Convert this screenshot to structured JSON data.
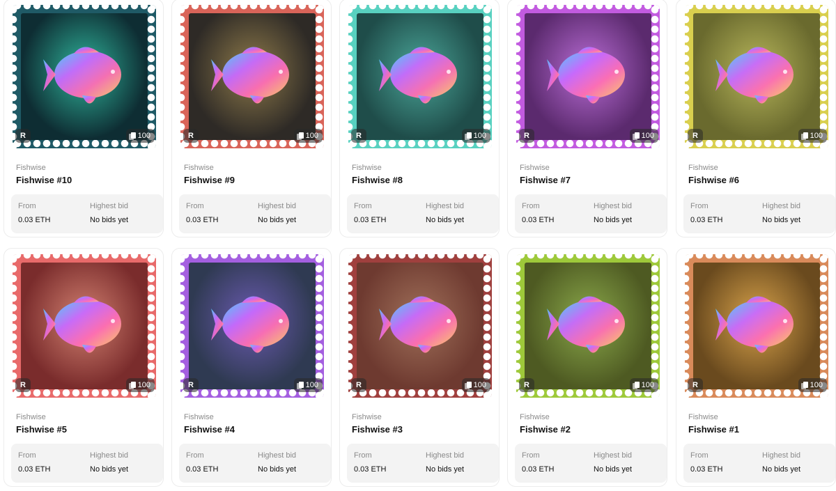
{
  "cards": [
    {
      "collection": "Fishwise",
      "title": "Fishwise #10",
      "rarity_badge": "R",
      "edition_count": "100",
      "price_label": "From",
      "price": "0.03 ETH",
      "bid_label": "Highest bid",
      "bid": "No bids yet",
      "frame_color": "#1f5a66",
      "bg_inner": "#0e2d33",
      "glow": "#2fb39a"
    },
    {
      "collection": "Fishwise",
      "title": "Fishwise #9",
      "rarity_badge": "R",
      "edition_count": "100",
      "price_label": "From",
      "price": "0.03 ETH",
      "bid_label": "Highest bid",
      "bid": "No bids yet",
      "frame_color": "#d96459",
      "bg_inner": "#2e2a26",
      "glow": "#8e7a4a"
    },
    {
      "collection": "Fishwise",
      "title": "Fishwise #8",
      "rarity_badge": "R",
      "edition_count": "100",
      "price_label": "From",
      "price": "0.03 ETH",
      "bid_label": "Highest bid",
      "bid": "No bids yet",
      "frame_color": "#58d1c0",
      "bg_inner": "#1f4d4a",
      "glow": "#4aa598"
    },
    {
      "collection": "Fishwise",
      "title": "Fishwise #7",
      "rarity_badge": "R",
      "edition_count": "100",
      "price_label": "From",
      "price": "0.03 ETH",
      "bid_label": "Highest bid",
      "bid": "No bids yet",
      "frame_color": "#c25be0",
      "bg_inner": "#5b2a6e",
      "glow": "#b86cd4"
    },
    {
      "collection": "Fishwise",
      "title": "Fishwise #6",
      "rarity_badge": "R",
      "edition_count": "100",
      "price_label": "From",
      "price": "0.03 ETH",
      "bid_label": "Highest bid",
      "bid": "No bids yet",
      "frame_color": "#d9cf4e",
      "bg_inner": "#6a6a2e",
      "glow": "#b6b55a"
    },
    {
      "collection": "Fishwise",
      "title": "Fishwise #5",
      "rarity_badge": "R",
      "edition_count": "100",
      "price_label": "From",
      "price": "0.03 ETH",
      "bid_label": "Highest bid",
      "bid": "No bids yet",
      "frame_color": "#e86a6a",
      "bg_inner": "#7a2c2c",
      "glow": "#d18070"
    },
    {
      "collection": "Fishwise",
      "title": "Fishwise #4",
      "rarity_badge": "R",
      "edition_count": "100",
      "price_label": "From",
      "price": "0.03 ETH",
      "bid_label": "Highest bid",
      "bid": "No bids yet",
      "frame_color": "#a45fe0",
      "bg_inner": "#2f3a52",
      "glow": "#6a5ab0"
    },
    {
      "collection": "Fishwise",
      "title": "Fishwise #3",
      "rarity_badge": "R",
      "edition_count": "100",
      "price_label": "From",
      "price": "0.03 ETH",
      "bid_label": "Highest bid",
      "bid": "No bids yet",
      "frame_color": "#a0403e",
      "bg_inner": "#6e3a30",
      "glow": "#a0705a"
    },
    {
      "collection": "Fishwise",
      "title": "Fishwise #2",
      "rarity_badge": "R",
      "edition_count": "100",
      "price_label": "From",
      "price": "0.03 ETH",
      "bid_label": "Highest bid",
      "bid": "No bids yet",
      "frame_color": "#9ec93a",
      "bg_inner": "#4e5a22",
      "glow": "#8aa84a"
    },
    {
      "collection": "Fishwise",
      "title": "Fishwise #1",
      "rarity_badge": "R",
      "edition_count": "100",
      "price_label": "From",
      "price": "0.03 ETH",
      "bid_label": "Highest bid",
      "bid": "No bids yet",
      "frame_color": "#d98a5a",
      "bg_inner": "#6a4a1e",
      "glow": "#d7a24a"
    }
  ]
}
